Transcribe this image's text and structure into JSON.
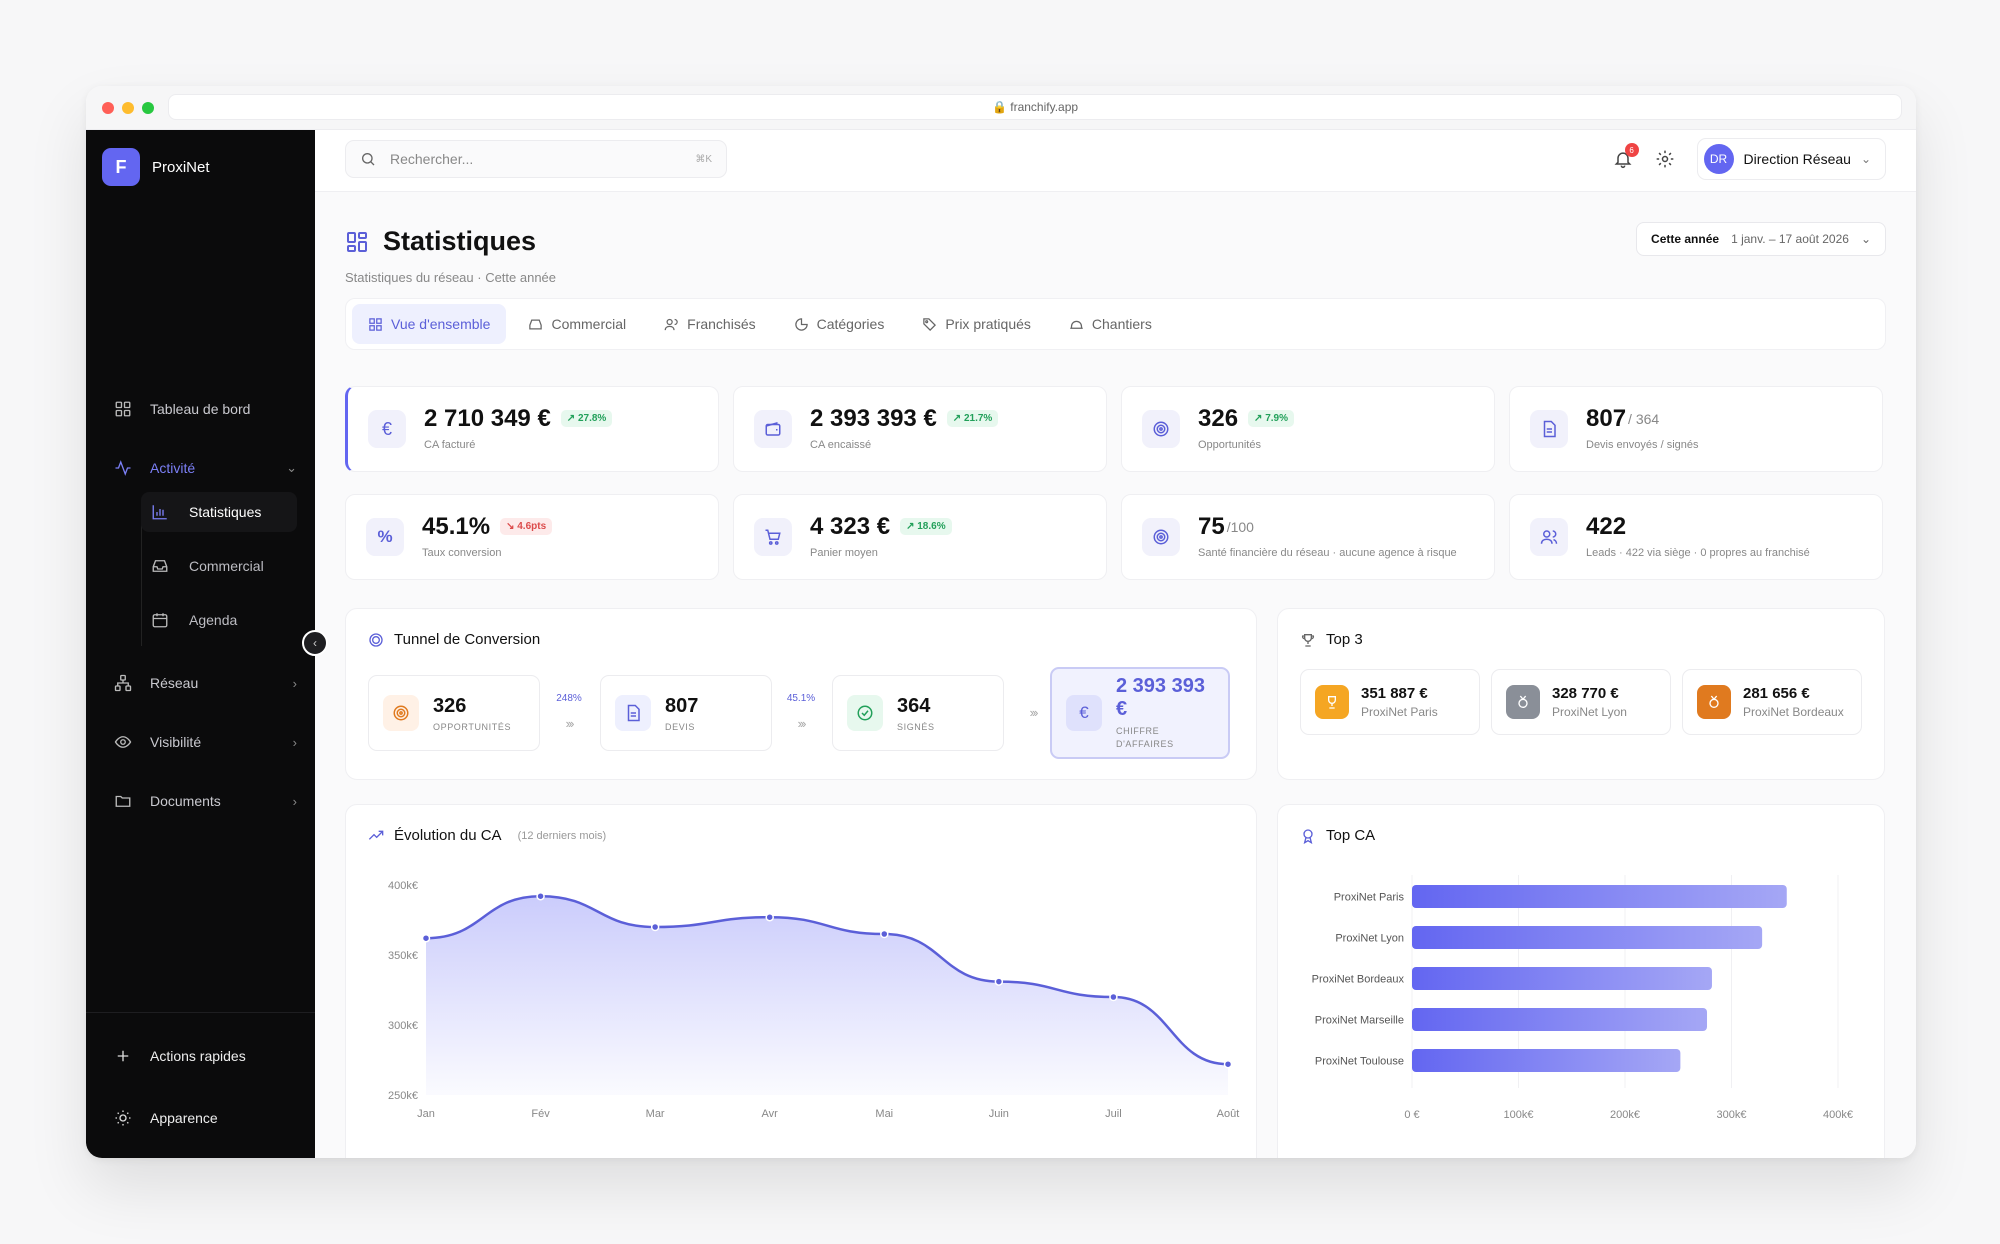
{
  "browser": {
    "url": "franchify.app"
  },
  "brand": {
    "logo_letter": "F",
    "name": "ProxiNet"
  },
  "sidebar": {
    "items": [
      {
        "label": "Tableau de bord"
      },
      {
        "label": "Activité"
      },
      {
        "label": "Réseau"
      },
      {
        "label": "Visibilité"
      },
      {
        "label": "Documents"
      }
    ],
    "sub_items": [
      {
        "label": "Statistiques"
      },
      {
        "label": "Commercial"
      },
      {
        "label": "Agenda"
      }
    ],
    "footer": [
      {
        "label": "Actions rapides"
      },
      {
        "label": "Apparence"
      }
    ]
  },
  "topbar": {
    "search_placeholder": "Rechercher...",
    "search_shortcut": "⌘K",
    "notification_count": "6",
    "user_initials": "DR",
    "user_name": "Direction Réseau"
  },
  "page": {
    "title": "Statistiques",
    "subtitle": "Statistiques du réseau · Cette année",
    "date_range_label": "Cette année",
    "date_range_value": "1 janv. – 17 août 2026"
  },
  "tabs": [
    {
      "label": "Vue d'ensemble"
    },
    {
      "label": "Commercial"
    },
    {
      "label": "Franchisés"
    },
    {
      "label": "Catégories"
    },
    {
      "label": "Prix pratiqués"
    },
    {
      "label": "Chantiers"
    }
  ],
  "kpis": [
    {
      "value": "2 710 349 €",
      "trend": "27.8%",
      "label": "CA facturé"
    },
    {
      "value": "2 393 393 €",
      "trend": "21.7%",
      "label": "CA encaissé"
    },
    {
      "value": "326",
      "trend": "7.9%",
      "label": "Opportunités"
    },
    {
      "value": "807",
      "suffix": "/ 364",
      "label": "Devis envoyés / signés"
    },
    {
      "value": "45.1%",
      "trend": "4.6pts",
      "label": "Taux conversion"
    },
    {
      "value": "4 323 €",
      "trend": "18.6%",
      "label": "Panier moyen"
    },
    {
      "value": "75",
      "suffix": "/100",
      "label": "Santé financière du réseau · aucune agence à risque"
    },
    {
      "value": "422",
      "label": "Leads · 422 via siège · 0 propres au franchisé"
    }
  ],
  "funnel": {
    "title": "Tunnel de Conversion",
    "steps": [
      {
        "value": "326",
        "label": "OPPORTUNITÉS"
      },
      {
        "value": "807",
        "label": "DEVIS"
      },
      {
        "value": "364",
        "label": "SIGNÉS"
      },
      {
        "value": "2 393 393 €",
        "label": "CHIFFRE D'AFFAIRES"
      }
    ],
    "rates": [
      "248%",
      "45.1%"
    ],
    "arrow": "›››"
  },
  "top3": {
    "title": "Top 3",
    "entries": [
      {
        "value": "351 887 €",
        "name": "ProxiNet Paris"
      },
      {
        "value": "328 770 €",
        "name": "ProxiNet Lyon"
      },
      {
        "value": "281 656 €",
        "name": "ProxiNet Bordeaux"
      }
    ]
  },
  "colors": {
    "accent": "#6366f1",
    "gold": "#f5a623",
    "silver": "#8a8f98",
    "bronze": "#e07a1f"
  },
  "chart_data": [
    {
      "type": "area",
      "title": "Évolution du CA",
      "subtitle": "(12 derniers mois)",
      "categories": [
        "Jan",
        "Fév",
        "Mar",
        "Avr",
        "Mai",
        "Juin",
        "Juil",
        "Août"
      ],
      "values": [
        362000,
        392000,
        370000,
        377000,
        365000,
        331000,
        320000,
        272000
      ],
      "ylim": [
        250000,
        400000
      ],
      "yticks": [
        "400k€",
        "350k€",
        "300k€",
        "250k€"
      ]
    },
    {
      "type": "bar",
      "orientation": "horizontal",
      "title": "Top CA",
      "categories": [
        "ProxiNet Paris",
        "ProxiNet Lyon",
        "ProxiNet Bordeaux",
        "ProxiNet Marseille",
        "ProxiNet Toulouse"
      ],
      "values": [
        351887,
        328770,
        281656,
        277000,
        252000
      ],
      "xlim": [
        0,
        400000
      ],
      "xticks": [
        "0 €",
        "100k€",
        "200k€",
        "300k€",
        "400k€"
      ]
    }
  ]
}
